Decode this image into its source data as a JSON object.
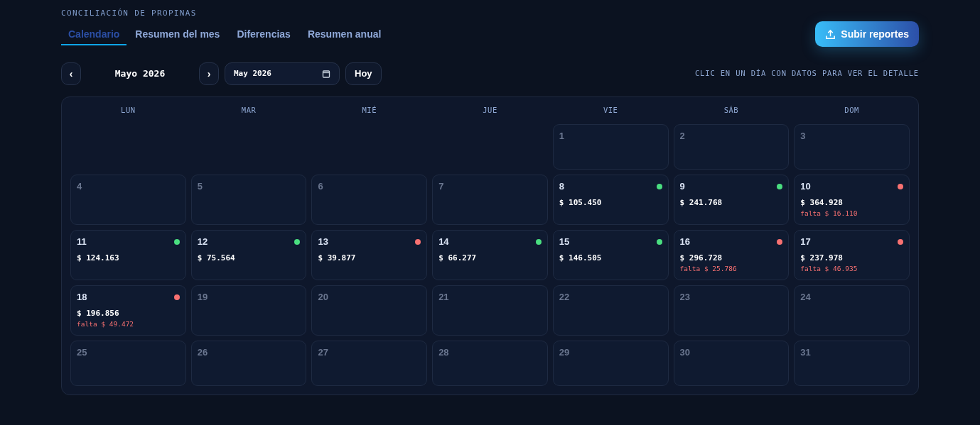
{
  "header": {
    "eyebrow": "CONCILIACIÓN DE PROPINAS",
    "upload_button": "Subir reportes"
  },
  "tabs": [
    {
      "label": "Calendario",
      "selected": true
    },
    {
      "label": "Resumen del mes",
      "selected": false
    },
    {
      "label": "Diferencias",
      "selected": false
    },
    {
      "label": "Resumen anual",
      "selected": false
    }
  ],
  "toolbar": {
    "prev": "‹",
    "month": "Mayo 2026",
    "next": "›",
    "month_field": "May 2026",
    "today": "Hoy",
    "hint": "CLIC EN UN DÍA CON DATOS PARA VER EL DETALLE"
  },
  "calendar": {
    "weekdays": [
      "LUN",
      "MAR",
      "MIÉ",
      "JUE",
      "VIE",
      "SÁB",
      "DOM"
    ],
    "cells": [
      {
        "kind": "blank"
      },
      {
        "kind": "blank"
      },
      {
        "kind": "blank"
      },
      {
        "kind": "blank"
      },
      {
        "kind": "day",
        "day": "1"
      },
      {
        "kind": "day",
        "day": "2"
      },
      {
        "kind": "day",
        "day": "3"
      },
      {
        "kind": "day",
        "day": "4"
      },
      {
        "kind": "day",
        "day": "5"
      },
      {
        "kind": "day",
        "day": "6"
      },
      {
        "kind": "day",
        "day": "7"
      },
      {
        "kind": "day",
        "day": "8",
        "amount": "$ 105.450",
        "color": "#4ade80"
      },
      {
        "kind": "day",
        "day": "9",
        "amount": "$ 241.768",
        "color": "#4ade80"
      },
      {
        "kind": "day",
        "day": "10",
        "amount": "$ 364.928",
        "missing": "falta $ 16.110",
        "color": "#f87171"
      },
      {
        "kind": "day",
        "day": "11",
        "amount": "$ 124.163",
        "color": "#4ade80"
      },
      {
        "kind": "day",
        "day": "12",
        "amount": "$ 75.564",
        "color": "#4ade80"
      },
      {
        "kind": "day",
        "day": "13",
        "amount": "$ 39.877",
        "color": "#f87171"
      },
      {
        "kind": "day",
        "day": "14",
        "amount": "$ 66.277",
        "color": "#4ade80"
      },
      {
        "kind": "day",
        "day": "15",
        "amount": "$ 146.505",
        "color": "#4ade80"
      },
      {
        "kind": "day",
        "day": "16",
        "amount": "$ 296.728",
        "missing": "falta $ 25.786",
        "color": "#f87171"
      },
      {
        "kind": "day",
        "day": "17",
        "amount": "$ 237.978",
        "missing": "falta $ 46.935",
        "color": "#f87171"
      },
      {
        "kind": "day",
        "day": "18",
        "amount": "$ 196.856",
        "missing": "falta $ 49.472",
        "color": "#f87171"
      },
      {
        "kind": "day",
        "day": "19"
      },
      {
        "kind": "day",
        "day": "20"
      },
      {
        "kind": "day",
        "day": "21"
      },
      {
        "kind": "day",
        "day": "22"
      },
      {
        "kind": "day",
        "day": "23"
      },
      {
        "kind": "day",
        "day": "24"
      },
      {
        "kind": "day",
        "day": "25"
      },
      {
        "kind": "day",
        "day": "26"
      },
      {
        "kind": "day",
        "day": "27"
      },
      {
        "kind": "day",
        "day": "28"
      },
      {
        "kind": "day",
        "day": "29"
      },
      {
        "kind": "day",
        "day": "30"
      },
      {
        "kind": "day",
        "day": "31"
      }
    ]
  }
}
